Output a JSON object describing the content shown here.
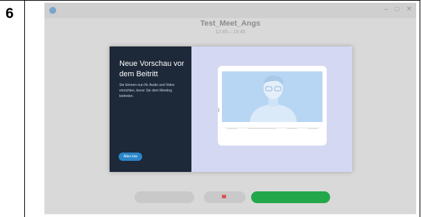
{
  "step": {
    "number": "6"
  },
  "window": {
    "app_title": "",
    "controls": [
      "–",
      "□",
      "✕"
    ]
  },
  "meeting": {
    "title": "Test_Meet_Angs",
    "subtitle": "12:45 – 13:45"
  },
  "modal": {
    "heading": "Neue Vorschau vor dem Beitritt",
    "body": "Sie können nun Ihr Audio und Video einrichten, bevor Sie dem Meeting beitreten.",
    "button_label": "Alles klar"
  },
  "footer": {
    "audio_label": "",
    "video_label": "",
    "join_label": ""
  },
  "colors": {
    "modal_left_bg": "#1d2838",
    "modal_right_bg": "#d4d8f2",
    "accent_blue": "#2a86c8",
    "join_green": "#22a84a"
  }
}
